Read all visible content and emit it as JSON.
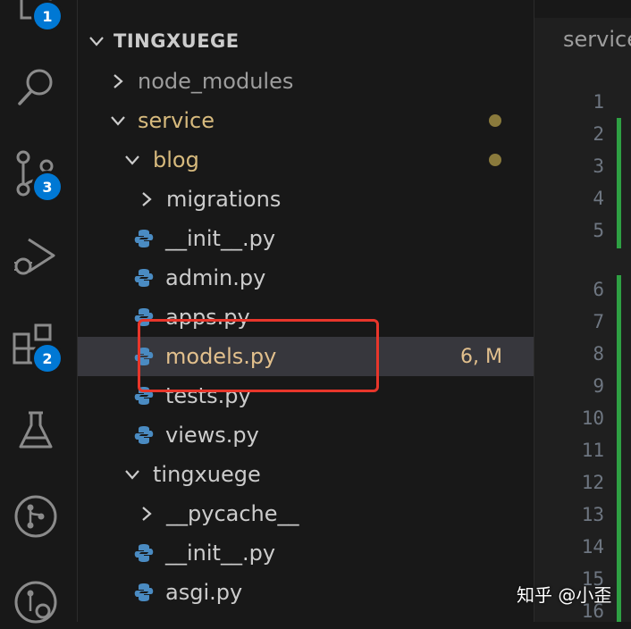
{
  "activity_bar": {
    "explorer_badge": "1",
    "source_control_badge": "3",
    "extensions_badge": "2"
  },
  "explorer": {
    "root": "TINGXUEGE",
    "items": [
      {
        "label": "node_modules"
      },
      {
        "label": "service"
      },
      {
        "label": "blog"
      },
      {
        "label": "migrations"
      },
      {
        "label": "__init__.py"
      },
      {
        "label": "admin.py"
      },
      {
        "label": "apps.py"
      },
      {
        "label": "models.py",
        "status": "6, M"
      },
      {
        "label": "tests.py"
      },
      {
        "label": "views.py"
      },
      {
        "label": "tingxuege"
      },
      {
        "label": "__pycache__"
      },
      {
        "label": "__init__.py"
      },
      {
        "label": "asgi.py"
      }
    ]
  },
  "editor": {
    "tab_label": "service",
    "line_numbers": [
      "1",
      "2",
      "3",
      "4",
      "5",
      "6",
      "7",
      "8",
      "9",
      "10",
      "11",
      "12",
      "13",
      "14",
      "15",
      "16"
    ]
  },
  "watermark": "知乎 @小歪",
  "colors": {
    "modified": "#e2c08d",
    "badge": "#0078d4",
    "highlight": "#e8362b",
    "git_added": "#2ea043"
  }
}
